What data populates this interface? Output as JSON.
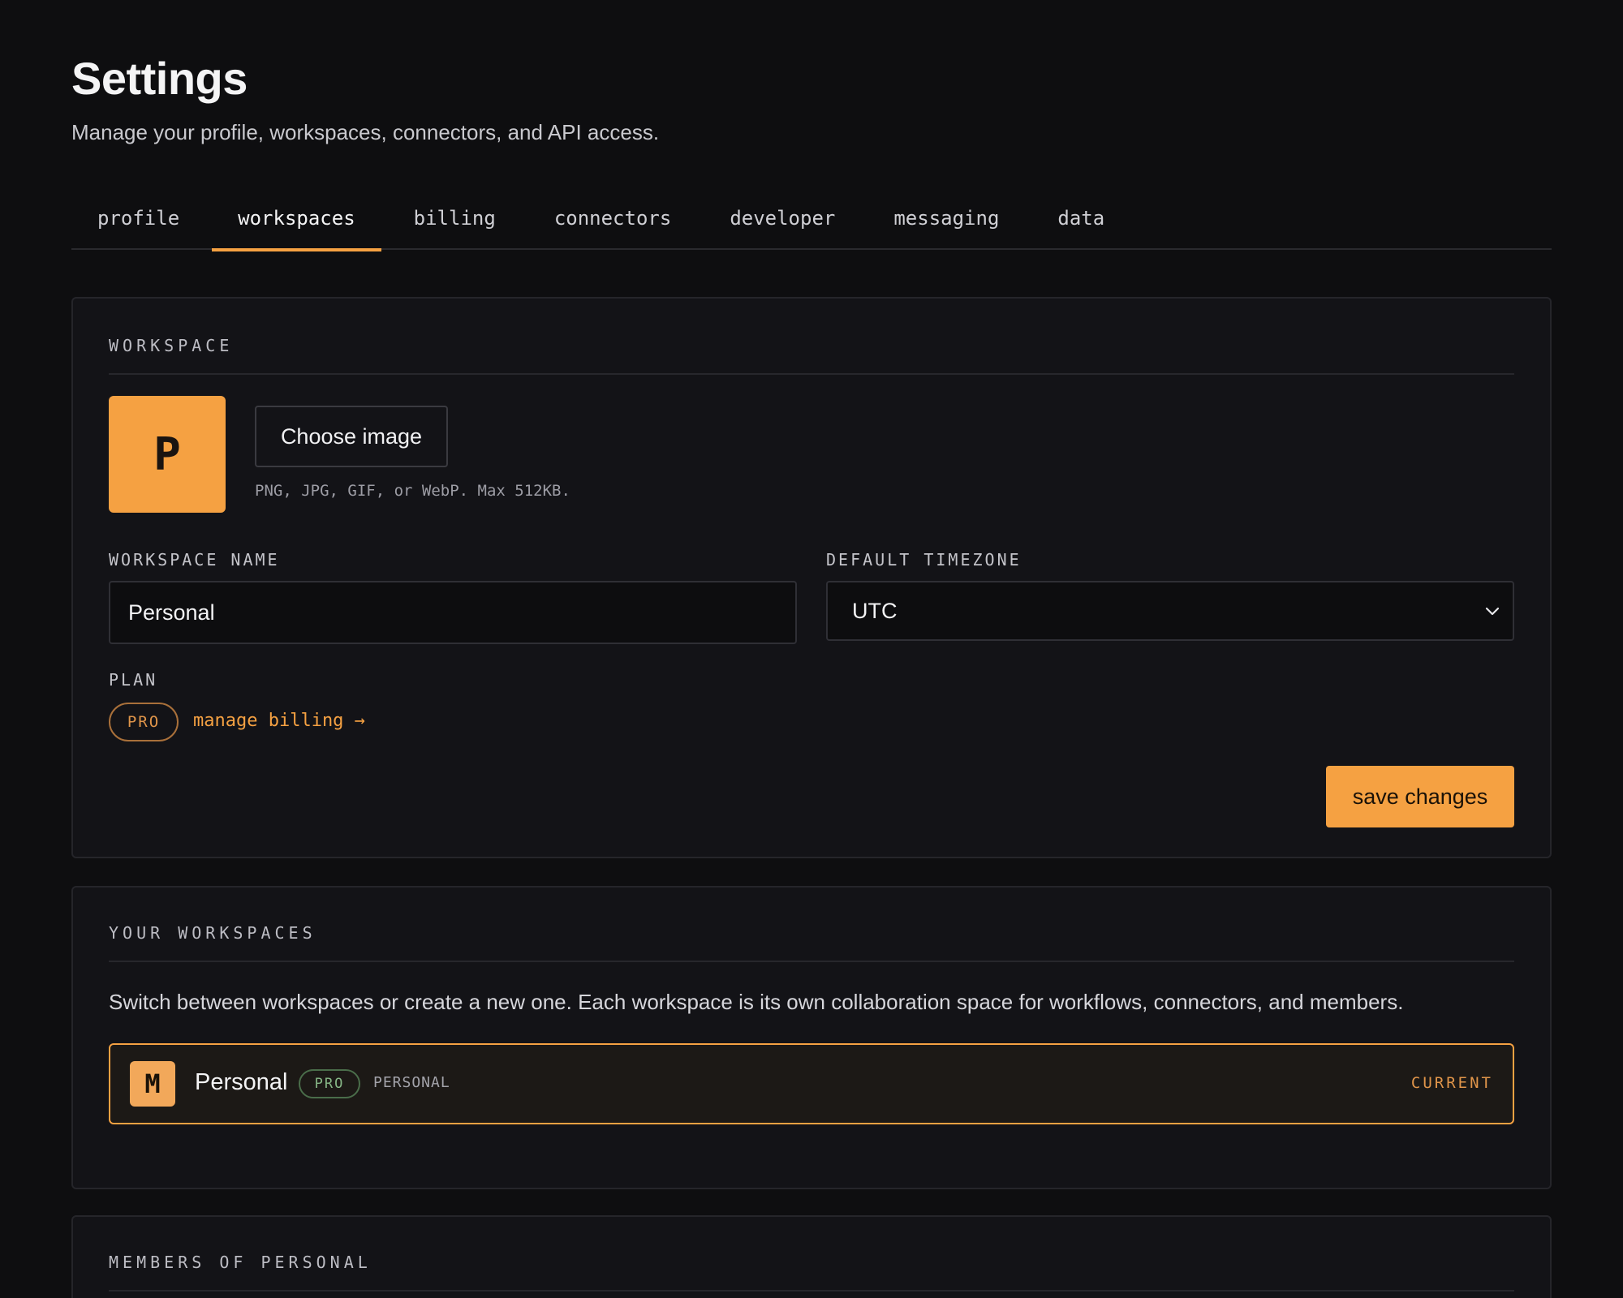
{
  "header": {
    "title": "Settings",
    "subtitle": "Manage your profile, workspaces, connectors, and API access."
  },
  "tabs": [
    {
      "label": "profile",
      "active": false
    },
    {
      "label": "workspaces",
      "active": true
    },
    {
      "label": "billing",
      "active": false
    },
    {
      "label": "connectors",
      "active": false
    },
    {
      "label": "developer",
      "active": false
    },
    {
      "label": "messaging",
      "active": false
    },
    {
      "label": "data",
      "active": false
    }
  ],
  "workspace": {
    "section_label": "WORKSPACE",
    "avatar_letter": "P",
    "choose_image_label": "Choose image",
    "image_hint": "PNG, JPG, GIF, or WebP. Max 512KB.",
    "name_label": "WORKSPACE NAME",
    "name_value": "Personal",
    "timezone_label": "DEFAULT TIMEZONE",
    "timezone_value": "UTC",
    "plan_label": "PLAN",
    "plan_badge": "PRO",
    "manage_billing_label": "manage billing →",
    "save_label": "save changes"
  },
  "your_workspaces": {
    "section_label": "YOUR WORKSPACES",
    "description": "Switch between workspaces or create a new one. Each workspace is its own collaboration space for workflows, connectors, and members.",
    "items": [
      {
        "avatar_letter": "M",
        "name": "Personal",
        "plan_badge": "PRO",
        "type": "PERSONAL",
        "status": "CURRENT"
      }
    ]
  },
  "members": {
    "section_label": "MEMBERS OF PERSONAL"
  },
  "colors": {
    "accent": "#f5a142",
    "background": "#0e0e10",
    "card": "#131317",
    "pro_badge_green": "#87b887"
  }
}
